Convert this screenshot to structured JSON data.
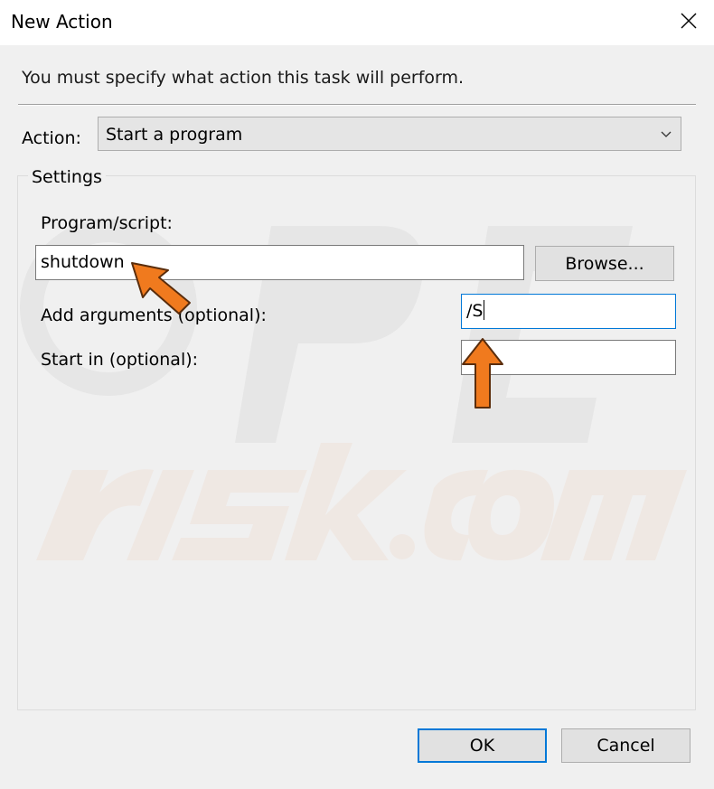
{
  "window": {
    "title": "New Action",
    "close_icon": "close-icon"
  },
  "instruction": "You must specify what action this task will perform.",
  "action": {
    "label": "Action:",
    "selected": "Start a program"
  },
  "settings": {
    "group_title": "Settings",
    "program_label": "Program/script:",
    "program_value": "shutdown",
    "browse_label": "Browse...",
    "arguments_label": "Add arguments (optional):",
    "arguments_value": "/S",
    "start_in_label": "Start in (optional):",
    "start_in_value": ""
  },
  "buttons": {
    "ok": "OK",
    "cancel": "Cancel"
  },
  "colors": {
    "accent": "#0078d7",
    "arrow": "#f07a1e",
    "dialog_bg": "#f0f0f0"
  }
}
